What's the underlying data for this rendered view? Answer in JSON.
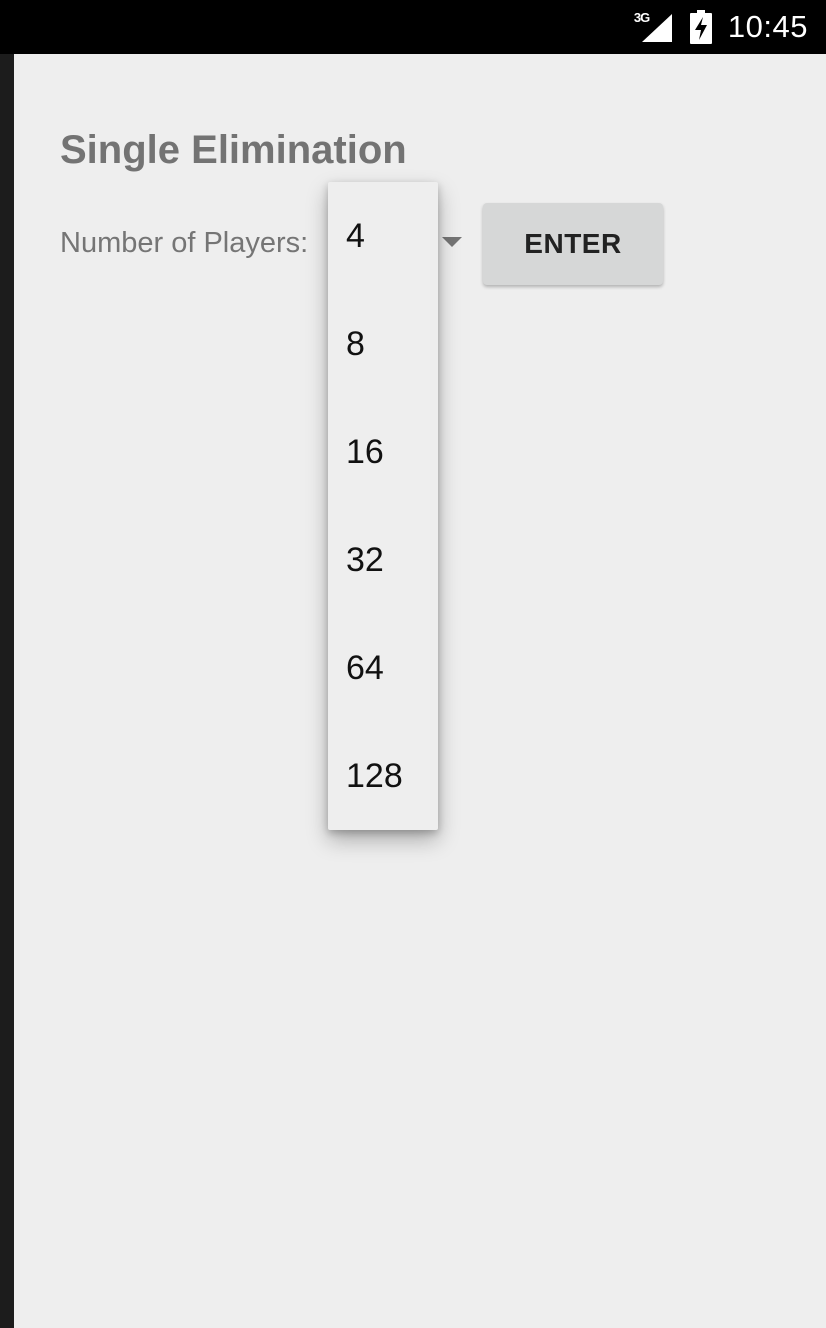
{
  "status_bar": {
    "network_type": "3G",
    "time": "10:45"
  },
  "screen": {
    "title": "Single Elimination",
    "players_label": "Number of Players:",
    "enter_button_label": "ENTER"
  },
  "dropdown": {
    "options": [
      "4",
      "8",
      "16",
      "32",
      "64",
      "128"
    ]
  }
}
